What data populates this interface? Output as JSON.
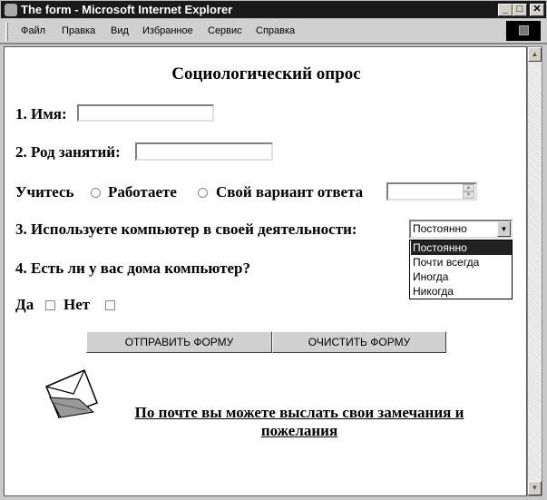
{
  "window": {
    "title": "The form - Microsoft Internet Explorer",
    "min": "_",
    "max": "□",
    "close": "✕"
  },
  "menu": [
    "Файл",
    "Правка",
    "Вид",
    "Избранное",
    "Сервис",
    "Справка"
  ],
  "form": {
    "heading": "Социологический опрос",
    "q1_label": "1. Имя:",
    "q1_value": "",
    "q2_label": "2. Род занятий:",
    "q2_value": "",
    "radio_study": "Учитесь",
    "radio_work": "Работаете",
    "radio_other": "Свой вариант ответа",
    "other_value": "",
    "q3_label": "3. Используете компьютер в своей деятельности:",
    "q3_selected": "Постоянно",
    "q3_options": [
      "Постоянно",
      "Почти всегда",
      "Иногда",
      "Никогда"
    ],
    "q4_label": "4. Есть ли у вас дома компьютер?",
    "yes": "Да",
    "no": "Нет",
    "submit": "ОТПРАВИТЬ ФОРМУ",
    "reset": "ОЧИСТИТЬ ФОРМУ",
    "mail_line1": "По почте вы можете выслать свои замечания и",
    "mail_line2": "пожелания"
  }
}
